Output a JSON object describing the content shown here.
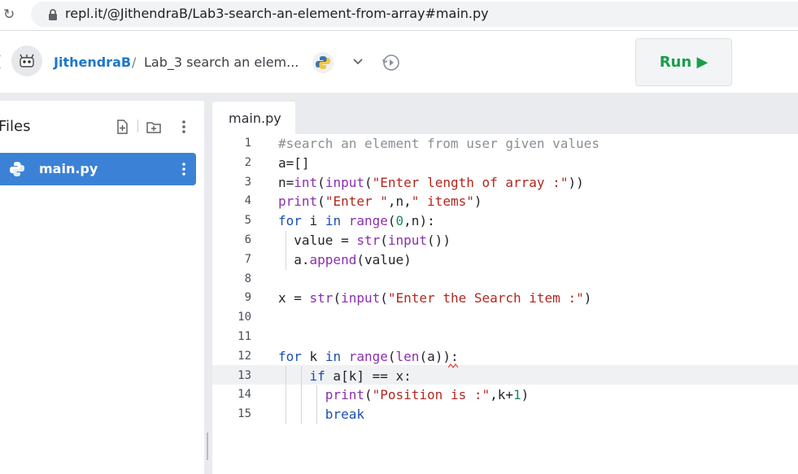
{
  "browser": {
    "url": "repl.it/@JithendraB/Lab3-search-an-element-from-array#main.py"
  },
  "header": {
    "username": "JithendraB",
    "separator": "/",
    "repl_name": "Lab_3 search an elem...",
    "run_label": "Run ▶"
  },
  "files_panel": {
    "title": "Files",
    "files": [
      {
        "name": "main.py",
        "selected": true
      }
    ]
  },
  "editor": {
    "tab_label": "main.py",
    "line_numbers": [
      "1",
      "2",
      "3",
      "4",
      "5",
      "6",
      "7",
      "8",
      "9",
      "10",
      "11",
      "12",
      "13",
      "14",
      "15"
    ]
  },
  "colors": {
    "run_green": "#1a9e4b",
    "selected_file_blue": "#3b82d6",
    "username_blue": "#1d77c9"
  }
}
